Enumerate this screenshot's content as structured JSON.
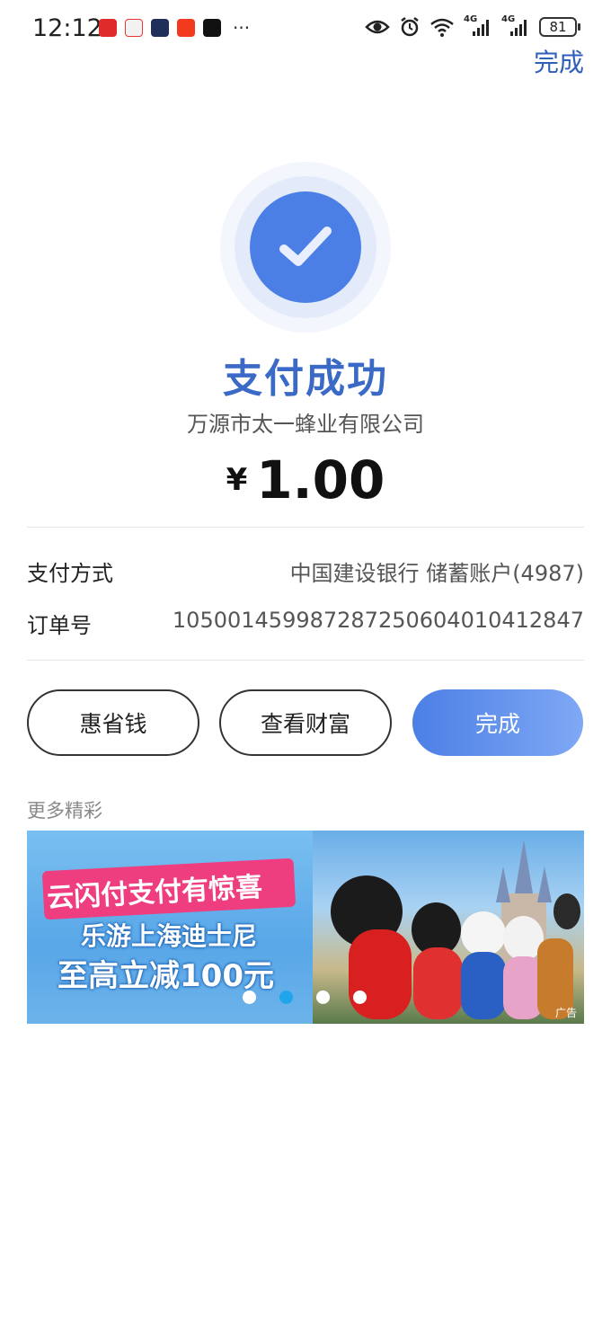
{
  "status_bar": {
    "time": "12:12",
    "more_glyph": "···",
    "network_1": "4G",
    "network_2": "4G",
    "battery": "81"
  },
  "header": {
    "done_label": "完成"
  },
  "result": {
    "title": "支付成功",
    "merchant": "万源市太一蜂业有限公司",
    "currency": "¥",
    "amount": "1.00"
  },
  "details": [
    {
      "label": "支付方式",
      "value": "中国建设银行 储蓄账户(4987)"
    },
    {
      "label": "订单号",
      "value": "1050014599872872506040104128​47"
    }
  ],
  "actions": {
    "save_money": "惠省钱",
    "view_wealth": "查看财富",
    "done": "完成"
  },
  "promo": {
    "section_title": "更多精彩",
    "headline": "云闪付支付有惊喜",
    "line1": "乐游上海迪士尼",
    "line2": "至高立减100元",
    "ad_tag": "广告",
    "pager_count": 4,
    "pager_active": 1
  },
  "colors": {
    "accent": "#3a69c6",
    "success_circle": "#4b7fe6",
    "pager_active": "#1fa5ea"
  }
}
